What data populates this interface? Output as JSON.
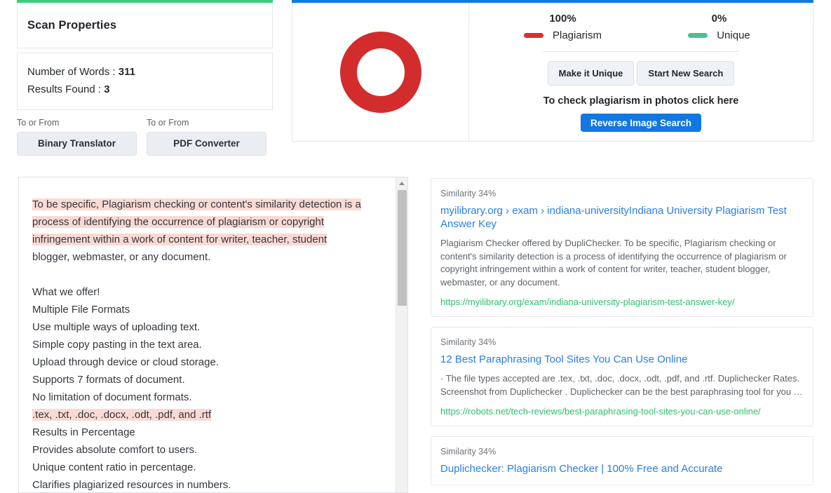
{
  "scan_properties": {
    "accent_color": "#3ECB7E",
    "title": "Scan Properties",
    "words_label": "Number of Words :",
    "words_value": "311",
    "results_label": "Results Found :",
    "results_value": "3",
    "tools": [
      {
        "label": "To or From",
        "button": "Binary Translator"
      },
      {
        "label": "To or From",
        "button": "PDF Converter"
      }
    ]
  },
  "summary": {
    "accent_color": "#0E7BE0",
    "donut": {
      "plagiarism_color": "#D32C2C",
      "unique_color": "#4CC08E"
    },
    "legend": [
      {
        "percent": "100%",
        "label": "Plagiarism",
        "color": "#D93030",
        "swatch": "legend-swatch-red"
      },
      {
        "percent": "0%",
        "label": "Unique",
        "color": "#4CC08E",
        "swatch": "legend-swatch-green"
      }
    ],
    "make_unique_button": "Make it Unique",
    "start_new_search_button": "Start New Search",
    "photo_note": "To check plagiarism in photos click here",
    "reverse_image_button": "Reverse Image Search",
    "reverse_image_color": "#1277E0"
  },
  "scanned_text": {
    "highlight_color": "#FBDAD4",
    "lines": [
      {
        "text": "To be specific, Plagiarism checking or content's similarity detection is a",
        "highlight": true
      },
      {
        "text": "process of identifying the occurrence of plagiarism or copyright",
        "highlight": true
      },
      {
        "text": "infringement within a work of content for writer, teacher, student",
        "highlight": true
      },
      {
        "text": "blogger, webmaster, or any document.",
        "highlight": false
      },
      {
        "text": "",
        "highlight": false
      },
      {
        "text": "What we offer!",
        "highlight": false
      },
      {
        "text": " Multiple File Formats",
        "highlight": false
      },
      {
        "text": "Use multiple ways of uploading text.",
        "highlight": false
      },
      {
        "text": "Simple copy pasting in the text area.",
        "highlight": false
      },
      {
        "text": "Upload through device or cloud storage.",
        "highlight": false
      },
      {
        "text": "Supports 7 formats of document.",
        "highlight": false
      },
      {
        "text": "No limitation of document formats.",
        "highlight": false
      },
      {
        "text": ".tex, .txt, .doc, .docx, .odt, .pdf, and .rtf",
        "highlight": true
      },
      {
        "text": " Results in Percentage",
        "highlight": false
      },
      {
        "text": "Provides absolute comfort to users.",
        "highlight": false
      },
      {
        "text": "Unique content ratio in percentage.",
        "highlight": false
      },
      {
        "text": "Clarifies plagiarized resources in numbers.",
        "highlight": false
      }
    ]
  },
  "results": [
    {
      "similarity": "Similarity 34%",
      "title": "myilibrary.org › exam › indiana-universityIndiana University Plagiarism Test Answer Key",
      "snippet": "Plagiarism Checker offered by DupliChecker. To be specific, Plagiarism checking or content's similarity detection is a process of identifying the occurrence of plagiarism or copyright infringement within a work of content for writer, teacher, student blogger, webmaster, or any document.",
      "url": "https://myilibrary.org/exam/indiana-university-plagiarism-test-answer-key/"
    },
    {
      "similarity": "Similarity 34%",
      "title": "12 Best Paraphrasing Tool Sites You Can Use Online",
      "snippet": " · The file types accepted are .tex, .txt, .doc, .docx, .odt, .pdf, and .rtf. Duplichecker Rates. Screenshot from Duplichecker . Duplichecker can be the best paraphrasing tool for you …",
      "url": "https://robots.net/tech-reviews/best-paraphrasing-tool-sites-you-can-use-online/"
    },
    {
      "similarity": "Similarity 34%",
      "title": "Duplichecker: Plagiarism Checker | 100% Free and Accurate",
      "snippet": "",
      "url": ""
    }
  ]
}
